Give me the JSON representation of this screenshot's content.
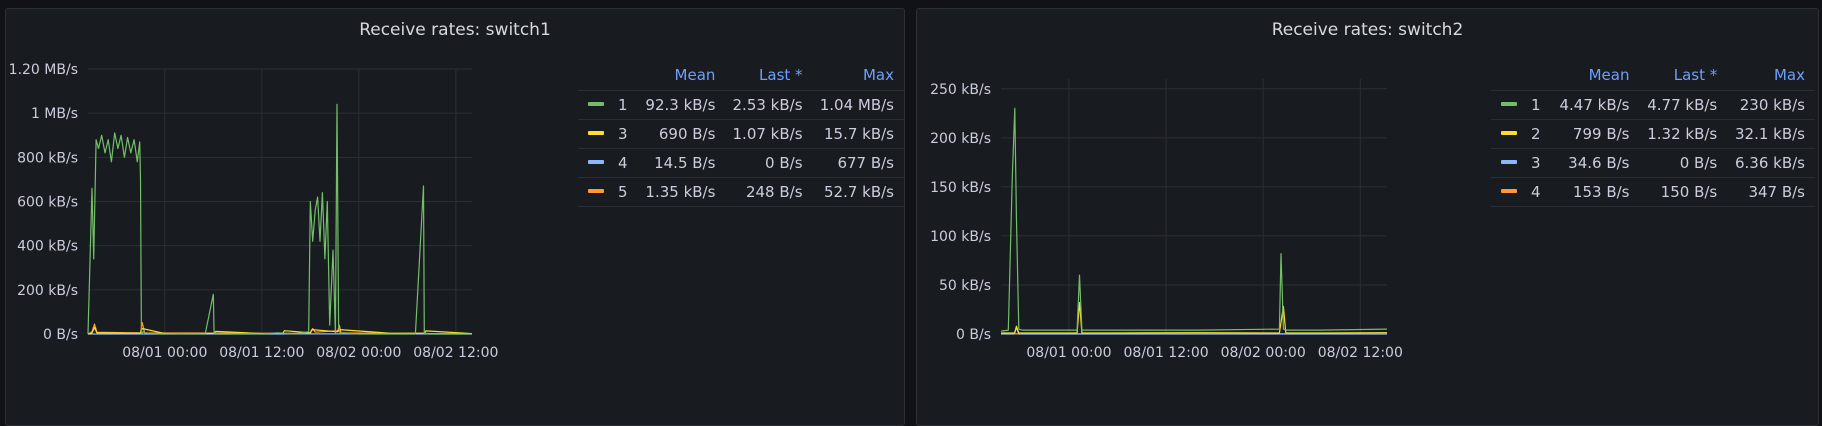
{
  "panels": [
    {
      "title": "Receive rates: switch1",
      "legend": {
        "headers": [
          "Mean",
          "Last *",
          "Max"
        ],
        "rows": [
          {
            "name": "1",
            "color": "#73bf69",
            "mean": "92.3 kB/s",
            "last": "2.53 kB/s",
            "max": "1.04 MB/s"
          },
          {
            "name": "3",
            "color": "#fade2a",
            "mean": "690 B/s",
            "last": "1.07 kB/s",
            "max": "15.7 kB/s"
          },
          {
            "name": "4",
            "color": "#8ab8ff",
            "mean": "14.5 B/s",
            "last": "0 B/s",
            "max": "677 B/s"
          },
          {
            "name": "5",
            "color": "#ff9830",
            "mean": "1.35 kB/s",
            "last": "248 B/s",
            "max": "52.7 kB/s"
          }
        ]
      }
    },
    {
      "title": "Receive rates: switch2",
      "legend": {
        "headers": [
          "Mean",
          "Last *",
          "Max"
        ],
        "rows": [
          {
            "name": "1",
            "color": "#73bf69",
            "mean": "4.47 kB/s",
            "last": "4.77 kB/s",
            "max": "230 kB/s"
          },
          {
            "name": "2",
            "color": "#fade2a",
            "mean": "799 B/s",
            "last": "1.32 kB/s",
            "max": "32.1 kB/s"
          },
          {
            "name": "3",
            "color": "#8ab8ff",
            "mean": "34.6 B/s",
            "last": "0 B/s",
            "max": "6.36 kB/s"
          },
          {
            "name": "4",
            "color": "#ff9830",
            "mean": "153 B/s",
            "last": "150 B/s",
            "max": "347 B/s"
          }
        ]
      }
    }
  ],
  "chart_data": [
    {
      "type": "line",
      "title": "Receive rates: switch1",
      "y_ticks": [
        "0 B/s",
        "200 kB/s",
        "400 kB/s",
        "600 kB/s",
        "800 kB/s",
        "1 MB/s",
        "1.20 MB/s"
      ],
      "y_tick_values_kBps": [
        0,
        200,
        400,
        600,
        800,
        1000,
        1200
      ],
      "ylim_kBps": [
        0,
        1200
      ],
      "x_ticks": [
        "08/01 00:00",
        "08/01 12:00",
        "08/02 00:00",
        "08/02 12:00"
      ],
      "x_tick_hours": [
        24,
        36,
        48,
        60
      ],
      "xlim_hours": [
        14.5,
        62
      ],
      "grid": true,
      "legend_placement": "right",
      "series": [
        {
          "name": "1",
          "color": "#73bf69",
          "x_hours": [
            14.5,
            15.0,
            15.2,
            15.5,
            15.8,
            16.2,
            16.6,
            17.0,
            17.4,
            17.8,
            18.2,
            18.6,
            19.0,
            19.4,
            19.8,
            20.2,
            20.6,
            20.9,
            21.0,
            21.1,
            21.3,
            21.6,
            22,
            24,
            26,
            29,
            30.0,
            30.1,
            30.3,
            30.6,
            32,
            34,
            36,
            38,
            40,
            41.8,
            42.0,
            42.3,
            42.6,
            42.9,
            43.2,
            43.5,
            43.8,
            44.1,
            44.4,
            44.8,
            45.1,
            45.3,
            45.5,
            45.7,
            46,
            48,
            52,
            55,
            56.0,
            56.1,
            56.3,
            56.6,
            58,
            62
          ],
          "values": [
            0,
            660,
            340,
            880,
            840,
            900,
            820,
            880,
            780,
            910,
            840,
            900,
            800,
            890,
            820,
            880,
            780,
            870,
            700,
            0,
            10,
            5,
            3,
            0,
            2,
            0,
            180,
            0,
            3,
            0,
            0,
            2,
            0,
            5,
            0,
            10,
            600,
            420,
            560,
            620,
            420,
            640,
            340,
            600,
            40,
            380,
            0,
            1040,
            40,
            0,
            5,
            0,
            0,
            0,
            670,
            0,
            3,
            0,
            0,
            0
          ]
        },
        {
          "name": "3",
          "color": "#fade2a",
          "x_hours": [
            14.5,
            15.0,
            15.3,
            15.6,
            21.0,
            21.2,
            24,
            30.1,
            30.3,
            36,
            38.6,
            38.8,
            42.0,
            42.2,
            45.4,
            45.6,
            52,
            56.1,
            56.3,
            62
          ],
          "values": [
            0,
            5,
            30,
            5,
            4,
            25,
            2,
            3,
            12,
            2,
            3,
            15,
            5,
            20,
            10,
            20,
            3,
            4,
            14,
            2
          ]
        },
        {
          "name": "4",
          "color": "#8ab8ff",
          "x_hours": [
            14.5,
            30,
            38.7,
            38.9,
            62
          ],
          "values": [
            0,
            0,
            0,
            0.7,
            0
          ]
        },
        {
          "name": "5",
          "color": "#ff9830",
          "x_hours": [
            14.5,
            15.0,
            15.3,
            15.6,
            21.0,
            21.2,
            21.5,
            42.0,
            42.3,
            42.6,
            45.4,
            45.6,
            45.8,
            62
          ],
          "values": [
            0,
            10,
            45,
            8,
            5,
            52,
            5,
            3,
            25,
            8,
            15,
            40,
            5,
            0.3
          ]
        }
      ]
    },
    {
      "type": "line",
      "title": "Receive rates: switch2",
      "y_ticks": [
        "0 B/s",
        "50 kB/s",
        "100 kB/s",
        "150 kB/s",
        "200 kB/s",
        "250 kB/s"
      ],
      "y_tick_values_kBps": [
        0,
        50,
        100,
        150,
        200,
        250
      ],
      "ylim_kBps": [
        0,
        260
      ],
      "x_ticks": [
        "08/01 00:00",
        "08/01 12:00",
        "08/02 00:00",
        "08/02 12:00"
      ],
      "x_tick_hours": [
        24,
        36,
        48,
        60
      ],
      "xlim_hours": [
        15.6,
        63.3
      ],
      "grid": true,
      "legend_placement": "right",
      "series": [
        {
          "name": "1",
          "color": "#73bf69",
          "x_hours": [
            15.6,
            16.5,
            17.0,
            17.3,
            17.5,
            17.8,
            18.2,
            20,
            25,
            25.3,
            25.6,
            26,
            30,
            40,
            50,
            50.2,
            50.5,
            50.8,
            55,
            63.3
          ],
          "values": [
            3,
            4,
            160,
            230,
            120,
            5,
            4,
            4,
            4,
            60,
            4,
            4,
            4,
            4,
            5,
            82,
            5,
            4,
            4,
            5
          ]
        },
        {
          "name": "2",
          "color": "#fade2a",
          "x_hours": [
            15.6,
            17.3,
            17.5,
            17.8,
            25,
            25.3,
            25.6,
            30,
            40,
            50,
            50.5,
            50.8,
            55,
            63.3
          ],
          "values": [
            1,
            1,
            8,
            1,
            1,
            32,
            1,
            1,
            1.3,
            1,
            28,
            1,
            1,
            1.3
          ]
        },
        {
          "name": "3",
          "color": "#8ab8ff",
          "x_hours": [
            15.6,
            17.2,
            17.5,
            17.8,
            63.3
          ],
          "values": [
            0,
            0,
            6.4,
            0,
            0
          ]
        },
        {
          "name": "4",
          "color": "#ff9830",
          "x_hours": [
            15.6,
            63.3
          ],
          "values": [
            0.15,
            0.15
          ]
        }
      ]
    }
  ]
}
